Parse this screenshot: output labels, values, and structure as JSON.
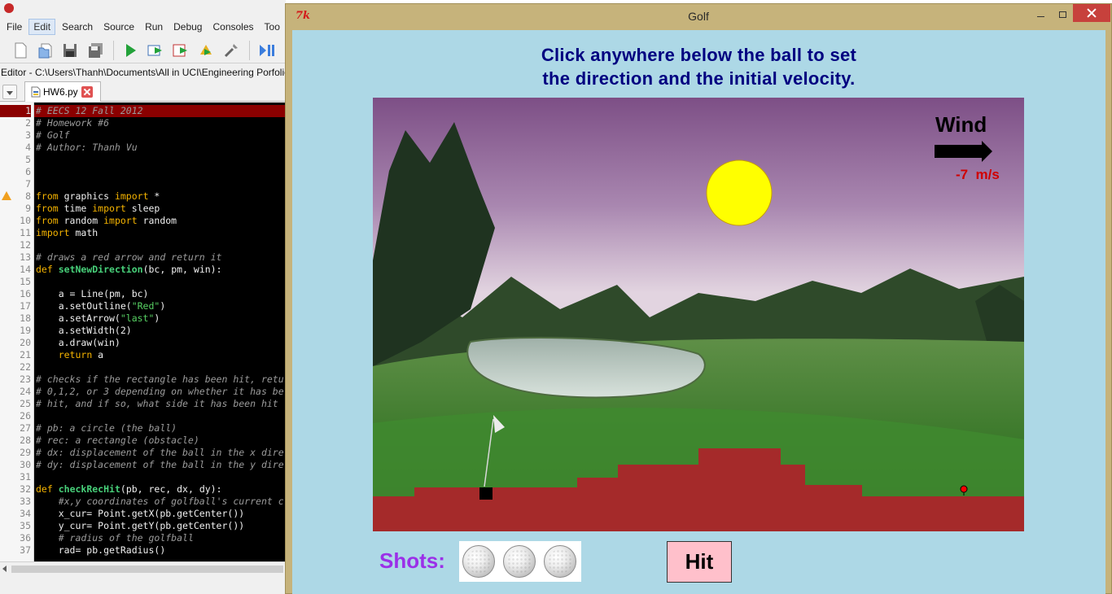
{
  "ide": {
    "menu": [
      "File",
      "Edit",
      "Search",
      "Source",
      "Run",
      "Debug",
      "Consoles",
      "Too"
    ],
    "active_menu": "Edit",
    "path": "Editor - C:\\Users\\Thanh\\Documents\\All in UCI\\Engineering Porfolio\\Progra",
    "tab_label": "HW6.py",
    "current_line": 1,
    "warning_line": 8,
    "code": [
      "# EECS 12 Fall 2012",
      "# Homework #6",
      "# Golf",
      "# Author: Thanh Vu",
      "",
      "",
      "",
      "from graphics import *",
      "from time import sleep",
      "from random import random",
      "import math",
      "",
      "# draws a red arrow and return it",
      "def setNewDirection(bc, pm, win):",
      "",
      "    a = Line(pm, bc)",
      "    a.setOutline(\"Red\")",
      "    a.setArrow(\"last\")",
      "    a.setWidth(2)",
      "    a.draw(win)",
      "    return a",
      "",
      "# checks if the rectangle has been hit, retu",
      "# 0,1,2, or 3 depending on whether it has be",
      "# hit, and if so, what side it has been hit",
      "",
      "# pb: a circle (the ball)",
      "# rec: a rectangle (obstacle)",
      "# dx: displacement of the ball in the x dire",
      "# dy: displacement of the ball in the y dire",
      "",
      "def checkRecHit(pb, rec, dx, dy):",
      "    #x,y coordinates of golfball's current c",
      "    x_cur= Point.getX(pb.getCenter())",
      "    y_cur= Point.getY(pb.getCenter())",
      "    # radius of the golfball",
      "    rad= pb.getRadius()"
    ]
  },
  "golf": {
    "window_title": "Golf",
    "tk_icon": "7k",
    "instruction_line1": "Click anywhere below the ball to set",
    "instruction_line2": "the direction and the initial velocity.",
    "wind_label": "Wind",
    "wind_speed": "-7  m/s",
    "wind_direction": "right-arrow-icon",
    "shots_label": "Shots:",
    "shots_remaining": 3,
    "hit_button": "Hit",
    "colors": {
      "background": "#add8e6",
      "instruction": "#000080",
      "sun": "#ffff00",
      "terrain": "#a52a2a",
      "wind_speed": "#d00000",
      "shots_label": "#9b30e8",
      "hit_button": "#ffc0cb"
    }
  }
}
